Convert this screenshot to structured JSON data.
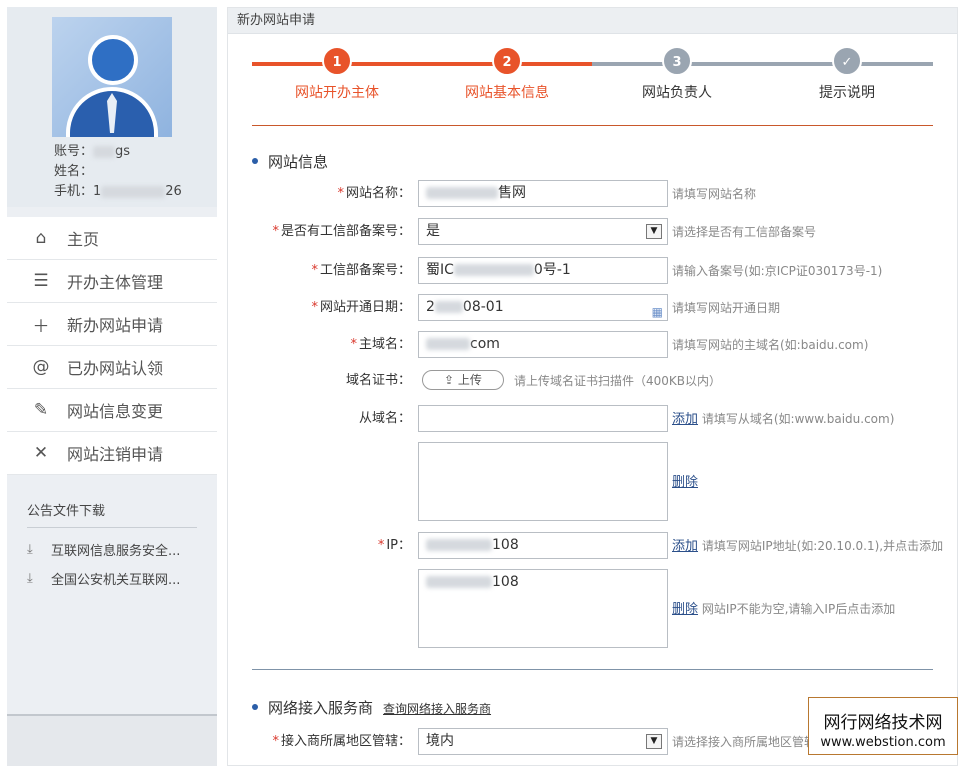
{
  "profile": {
    "account_label": "账号：",
    "account_suffix": "gs",
    "name_label": "姓名：",
    "phone_label": "手机：1",
    "phone_suffix": "26"
  },
  "nav": [
    {
      "label": "主页",
      "icon": "home-icon",
      "glyph": "⌂"
    },
    {
      "label": "开办主体管理",
      "icon": "list-icon",
      "glyph": "☰"
    },
    {
      "label": "新办网站申请",
      "icon": "plus-icon",
      "glyph": "＋"
    },
    {
      "label": "已办网站认领",
      "icon": "at-icon",
      "glyph": "@"
    },
    {
      "label": "网站信息变更",
      "icon": "edit-icon",
      "glyph": "✎"
    },
    {
      "label": "网站注销申请",
      "icon": "close-icon",
      "glyph": "✕"
    }
  ],
  "notice": {
    "title": "公告文件下载",
    "docs": [
      "互联网信息服务安全...",
      "全国公安机关互联网..."
    ]
  },
  "panel_title": "新办网站申请",
  "steps": [
    {
      "num": "1",
      "label": "网站开办主体",
      "state": "done"
    },
    {
      "num": "2",
      "label": "网站基本信息",
      "state": "current"
    },
    {
      "num": "3",
      "label": "网站负责人",
      "state": "todo"
    },
    {
      "num": "✓",
      "label": "提示说明",
      "state": "todo"
    }
  ],
  "colors": {
    "active": "#e8532a",
    "inactive": "#9aa5b1",
    "active_text": "#e8532a",
    "inactive_text": "#333333"
  },
  "section1": {
    "title": "网站信息"
  },
  "form": {
    "site_name": {
      "label": "网站名称：",
      "value_suffix": "售网",
      "hint": "请填写网站名称"
    },
    "has_icp": {
      "label": "是否有工信部备案号：",
      "value": "是",
      "hint": "请选择是否有工信部备案号"
    },
    "icp_no": {
      "label": "工信部备案号：",
      "value_prefix": "蜀IC",
      "value_suffix": "0号-1",
      "hint": "请输入备案号(如:京ICP证030173号-1)"
    },
    "open_date": {
      "label": "网站开通日期：",
      "value_prefix": "2",
      "value_suffix": "08-01",
      "hint": "请填写网站开通日期"
    },
    "main_domain": {
      "label": "主域名：",
      "value_suffix": "com",
      "hint": "请填写网站的主域名(如:baidu.com)"
    },
    "domain_cert": {
      "label": "域名证书：",
      "button": "上传",
      "hint": "请上传域名证书扫描件（400KB以内）"
    },
    "sub_domain": {
      "label": "从域名：",
      "placeholder": "",
      "add": "添加",
      "hint": "请填写从域名(如:www.baidu.com)",
      "delete": "删除"
    },
    "ip": {
      "label": "IP：",
      "value_suffix": "108",
      "add": "添加",
      "hint": "请填写网站IP地址(如:20.10.0.1),并点击添加",
      "list_suffix": "108",
      "delete": "删除",
      "delete_hint": "网站IP不能为空,请输入IP后点击添加"
    }
  },
  "section2": {
    "title": "网络接入服务商",
    "link": "查询网络接入服务商"
  },
  "isp_region": {
    "label": "接入商所属地区管辖：",
    "value": "境内",
    "hint": "请选择接入商所属地区管辖"
  },
  "watermark": {
    "line1": "网行网络技术网",
    "line2": "www.webstion.com"
  }
}
